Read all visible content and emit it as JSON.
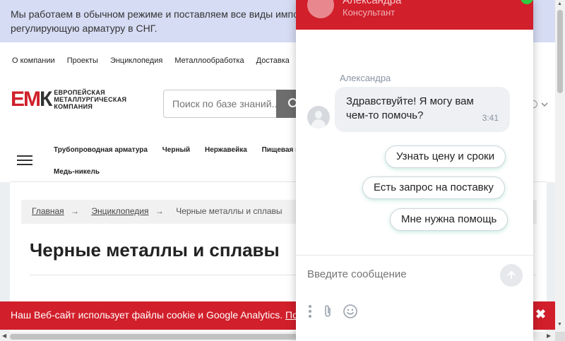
{
  "banner": {
    "text": "Мы работаем в обычном режиме и поставляем все виды импо",
    "text2": "регулирующую арматуру в СНГ."
  },
  "topnav": [
    "О компании",
    "Проекты",
    "Энциклопедия",
    "Металлообработка",
    "Доставка",
    "В"
  ],
  "logo": {
    "line1": "ЕВРОПЕЙСКАЯ",
    "line2": "МЕТАЛЛУРГИЧЕСКАЯ",
    "line3": "КОМПАНИЯ"
  },
  "search": {
    "placeholder": "Поиск по базе знаний..."
  },
  "catnav": {
    "items": [
      "Трубопроводная арматура",
      "Черный",
      "Нержавейка",
      "Пищевая не"
    ],
    "second": "Медь-никель"
  },
  "breadcrumb": {
    "home": "Главная",
    "sep": "→",
    "encyclopedia": "Энциклопедия",
    "current": "Черные металлы и сплавы"
  },
  "page_title": "Черные металлы и сплавы",
  "cookie": {
    "text": "Наш Веб-сайт использует файлы cookie и Google Analytics.",
    "link": "По",
    "close": "✖"
  },
  "chat": {
    "agent_name": "Александра",
    "agent_role": "Консультант",
    "message_author": "Александра",
    "message_line1": "Здравствуйте! Я могу вам",
    "message_line2": "чем-то помочь?",
    "message_time": "3:41",
    "quick_replies": [
      "Узнать цену и сроки",
      "Есть запрос на поставку",
      "Мне нужна помощь"
    ],
    "input_placeholder": "Введите сообщение"
  },
  "colors": {
    "brand_red": "#d11f2b",
    "banner_bg": "#d6dcf4",
    "online": "#2ecc40"
  }
}
